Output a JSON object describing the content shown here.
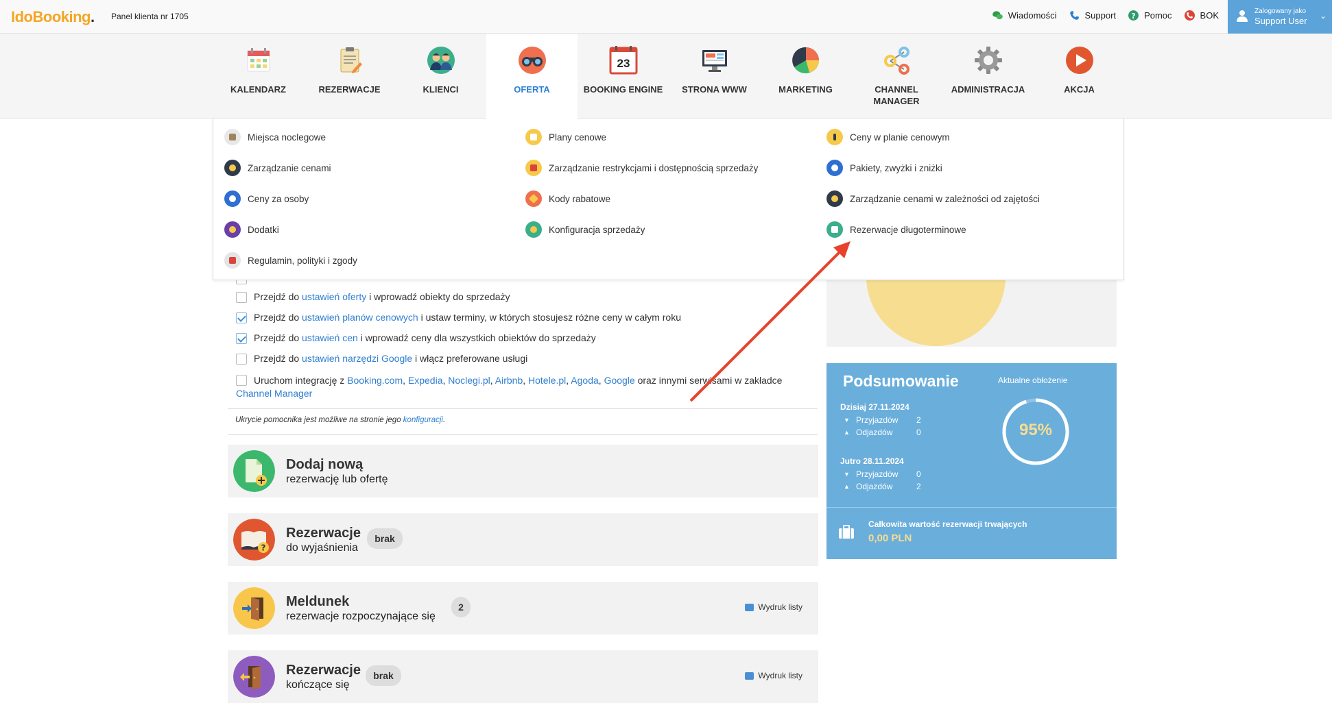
{
  "topbar": {
    "logo_ido": "Ido",
    "logo_booking": "Booking",
    "logo_dot": ".",
    "panel_nr": "Panel klienta nr 1705",
    "links": [
      {
        "label": "Wiadomości",
        "icon": "chat-icon",
        "color": "#2e9b4b"
      },
      {
        "label": "Support",
        "icon": "phone-icon",
        "color": "#2f7fd1"
      },
      {
        "label": "Pomoc",
        "icon": "help-icon",
        "color": "#2e9b6b"
      },
      {
        "label": "BOK",
        "icon": "phone-red-icon",
        "color": "#d9453a"
      }
    ],
    "user_line1": "Zalogowany jako",
    "user_line2": "Support User"
  },
  "nav": {
    "items": [
      {
        "label": "KALENDARZ",
        "icon": "calendar-icon"
      },
      {
        "label": "REZERWACJE",
        "icon": "clipboard-icon"
      },
      {
        "label": "KLIENCI",
        "icon": "clients-icon"
      },
      {
        "label": "OFERTA",
        "icon": "binoculars-icon",
        "active": true
      },
      {
        "label": "BOOKING ENGINE",
        "icon": "calendar-23-icon",
        "day": "23"
      },
      {
        "label": "STRONA WWW",
        "icon": "monitor-icon"
      },
      {
        "label": "MARKETING",
        "icon": "pie-chart-icon"
      },
      {
        "label": "CHANNEL MANAGER",
        "icon": "share-icon"
      },
      {
        "label": "ADMINISTRACJA",
        "icon": "gear-icon"
      },
      {
        "label": "AKCJA",
        "icon": "play-icon"
      }
    ]
  },
  "dropdown": {
    "col1": [
      "Miejsca noclegowe",
      "Zarządzanie cenami",
      "Ceny za osoby",
      "Dodatki",
      "Regulamin, polityki i zgody"
    ],
    "col2": [
      "Plany cenowe",
      "Zarządzanie restrykcjami i dostępnością sprzedaży",
      "Kody rabatowe",
      "Konfiguracja sprzedaży"
    ],
    "col3": [
      "Ceny w planie cenowym",
      "Pakiety, zwyżki i zniżki",
      "Zarządzanie cenami w zależności od zajętości",
      "Rezerwacje długoterminowe"
    ]
  },
  "checklist": {
    "items": [
      {
        "checked": false,
        "pre": "Przejdź do ",
        "link": "ustawień oferty",
        "post": " i wprowadź obiekty do sprzedaży"
      },
      {
        "checked": true,
        "pre": "Przejdź do ",
        "link": "ustawień planów cenowych",
        "post": " i ustaw terminy, w których stosujesz różne ceny w całym roku"
      },
      {
        "checked": true,
        "pre": "Przejdź do ",
        "link": "ustawień cen",
        "post": " i wprowadź ceny dla wszystkich obiektów do sprzedaży"
      },
      {
        "checked": false,
        "pre": "Przejdź do ",
        "link": "ustawień narzędzi Google",
        "post": " i włącz preferowane usługi"
      }
    ],
    "integration": {
      "pre": "Uruchom integrację z ",
      "links": [
        "Booking.com",
        "Expedia",
        "Noclegi.pl",
        "Airbnb",
        "Hotele.pl",
        "Agoda",
        "Google"
      ],
      "post": " oraz innymi serwisami w zakładce",
      "last_link": "Channel Manager"
    },
    "note_pre": "Ukrycie pomocnika jest możliwe na stronie jego ",
    "note_link": "konfiguracji",
    "note_post": "."
  },
  "cards": [
    {
      "title": "Dodaj nową",
      "sub": "rezerwację lub ofertę",
      "color": "#3cb86d",
      "icon": "add-document-icon"
    },
    {
      "title": "Rezerwacje",
      "sub": "do wyjaśnienia",
      "badge": "brak",
      "color": "#e0572f",
      "icon": "book-question-icon"
    },
    {
      "title": "Meldunek",
      "sub": "rezerwacje rozpoczynające się",
      "badge": "2",
      "print": "Wydruk listy",
      "color": "#f8c64a",
      "icon": "door-enter-icon"
    },
    {
      "title": "Rezerwacje",
      "sub": "kończące się",
      "badge": "brak",
      "print": "Wydruk listy",
      "color": "#8e5bbf",
      "icon": "door-exit-icon"
    }
  ],
  "summary": {
    "title": "Podsumowanie",
    "occupancy_label": "Aktualne obłożenie",
    "occupancy_value": "95%",
    "occupancy_fraction": 0.95,
    "today_label": "Dzisiaj 27.11.2024",
    "today_arrivals_label": "Przyjazdów",
    "today_arrivals": "2",
    "today_departures_label": "Odjazdów",
    "today_departures": "0",
    "tomorrow_label": "Jutro 28.11.2024",
    "tomorrow_arrivals_label": "Przyjazdów",
    "tomorrow_arrivals": "0",
    "tomorrow_departures_label": "Odjazdów",
    "tomorrow_departures": "2",
    "total_label": "Całkowita wartość rezerwacji trwających",
    "total_value": "0,00 PLN"
  }
}
